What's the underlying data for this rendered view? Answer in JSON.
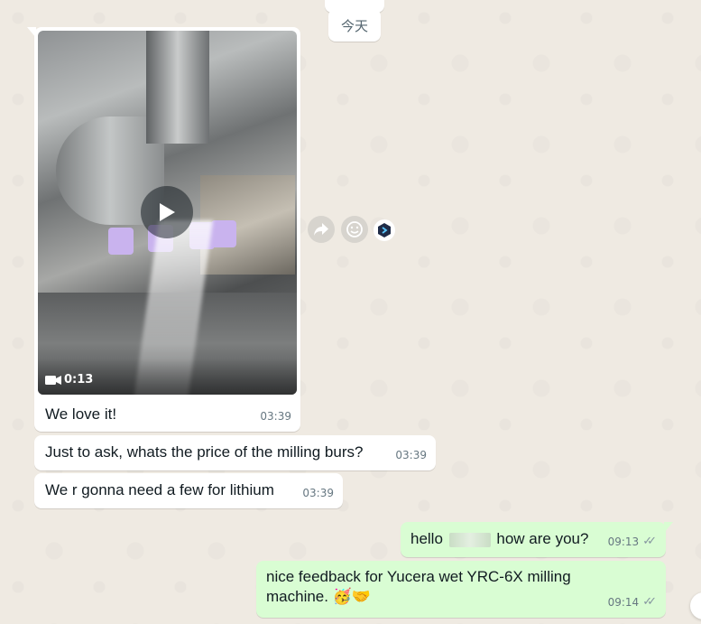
{
  "chat": {
    "date_separator": "今天",
    "video_message": {
      "duration": "0:13",
      "caption": "We love it!",
      "time": "03:39"
    },
    "messages": [
      {
        "direction": "in",
        "text": "Just to ask, whats the price of the milling burs?",
        "time": "03:39"
      },
      {
        "direction": "in",
        "text": "We r gonna need a few for lithium",
        "time": "03:39"
      },
      {
        "direction": "out",
        "text_before": "hello",
        "text_after": "how are you?",
        "time": "09:13",
        "status": "read"
      },
      {
        "direction": "out",
        "text": "nice feedback for Yucera wet YRC-6X milling machine.",
        "emoji": "🥳🤝",
        "time": "09:14",
        "status": "read"
      }
    ]
  },
  "hover_actions": {
    "icons": [
      "forward-icon",
      "emoji-reaction-icon",
      "ai-assistant-icon"
    ]
  },
  "colors": {
    "chat_background": "#efeae2",
    "incoming_bubble": "#ffffff",
    "outgoing_bubble": "#d9fdd3",
    "timestamp": "#667781"
  }
}
